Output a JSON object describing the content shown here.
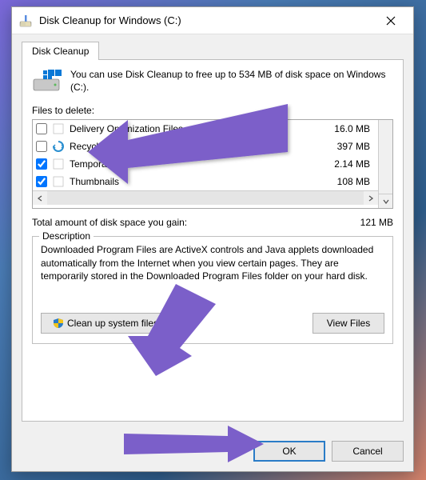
{
  "window": {
    "title": "Disk Cleanup for Windows (C:)"
  },
  "tab": {
    "label": "Disk Cleanup"
  },
  "intro": {
    "text": "You can use Disk Cleanup to free up to 534 MB of disk space on Windows (C:)."
  },
  "labels": {
    "files_to_delete": "Files to delete:",
    "total_label": "Total amount of disk space you gain:",
    "total_value": "121 MB",
    "description_legend": "Description"
  },
  "files": [
    {
      "checked": false,
      "icon": "blank",
      "name": "Delivery Optimization Files",
      "size": "16.0 MB"
    },
    {
      "checked": false,
      "icon": "recycle",
      "name": "Recycle Bin",
      "size": "397 MB"
    },
    {
      "checked": true,
      "icon": "blank",
      "name": "Temporary files",
      "size": "2.14 MB"
    },
    {
      "checked": true,
      "icon": "blank",
      "name": "Thumbnails",
      "size": "108 MB"
    }
  ],
  "description": {
    "text": "Downloaded Program Files are ActiveX controls and Java applets downloaded automatically from the Internet when you view certain pages. They are temporarily stored in the Downloaded Program Files folder on your hard disk."
  },
  "buttons": {
    "cleanup_system": "Clean up system files",
    "view_files": "View Files",
    "ok": "OK",
    "cancel": "Cancel"
  }
}
